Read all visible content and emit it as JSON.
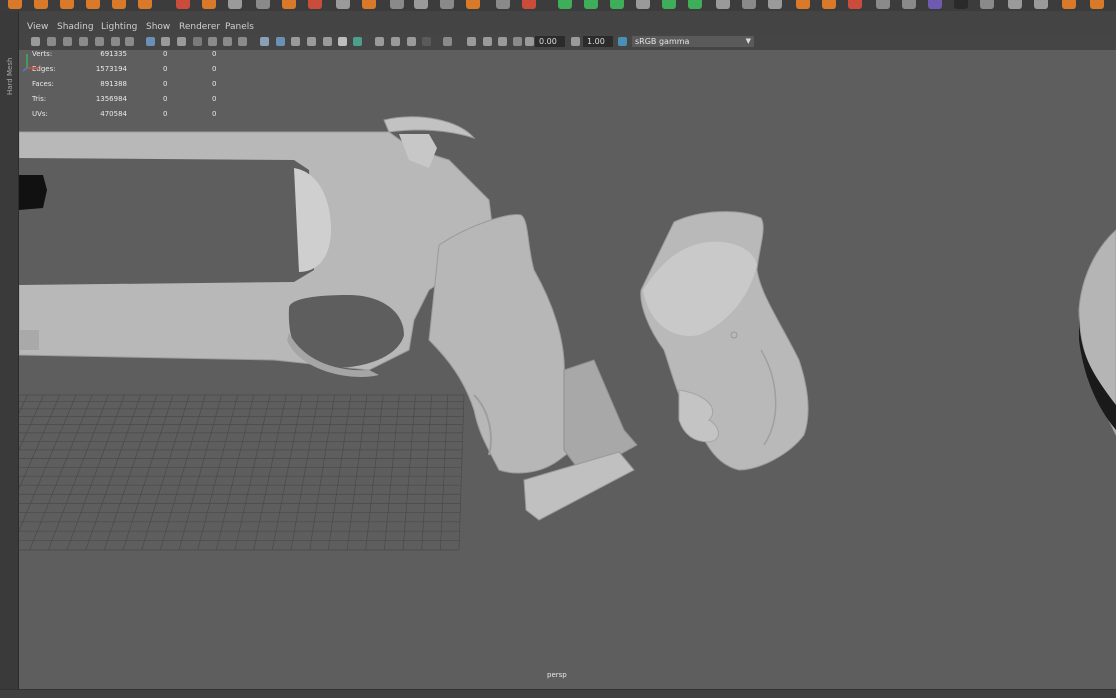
{
  "left_rail": {
    "label": "Hard Mesh"
  },
  "panel_menu": [
    "View",
    "Shading",
    "Lighting",
    "Show",
    "Renderer",
    "Panels"
  ],
  "toolbar": {
    "near_clip": "0.00",
    "exposure": "1.00",
    "color_management": "sRGB gamma"
  },
  "hud": {
    "rows": [
      {
        "label": "Verts:",
        "value": "691335",
        "c1": "0",
        "c2": "0"
      },
      {
        "label": "Edges:",
        "value": "1573194",
        "c1": "0",
        "c2": "0"
      },
      {
        "label": "Faces:",
        "value": "891388",
        "c1": "0",
        "c2": "0"
      },
      {
        "label": "Tris:",
        "value": "1356984",
        "c1": "0",
        "c2": "0"
      },
      {
        "label": "UVs:",
        "value": "470584",
        "c1": "0",
        "c2": "0"
      }
    ]
  },
  "viewport": {
    "camera": "persp"
  },
  "colors": {
    "viewport_bg": "#5e5e5e",
    "mesh": "#b8b8b8",
    "shelf_orange": "#d97a2b",
    "shelf_green": "#3fae5a"
  }
}
